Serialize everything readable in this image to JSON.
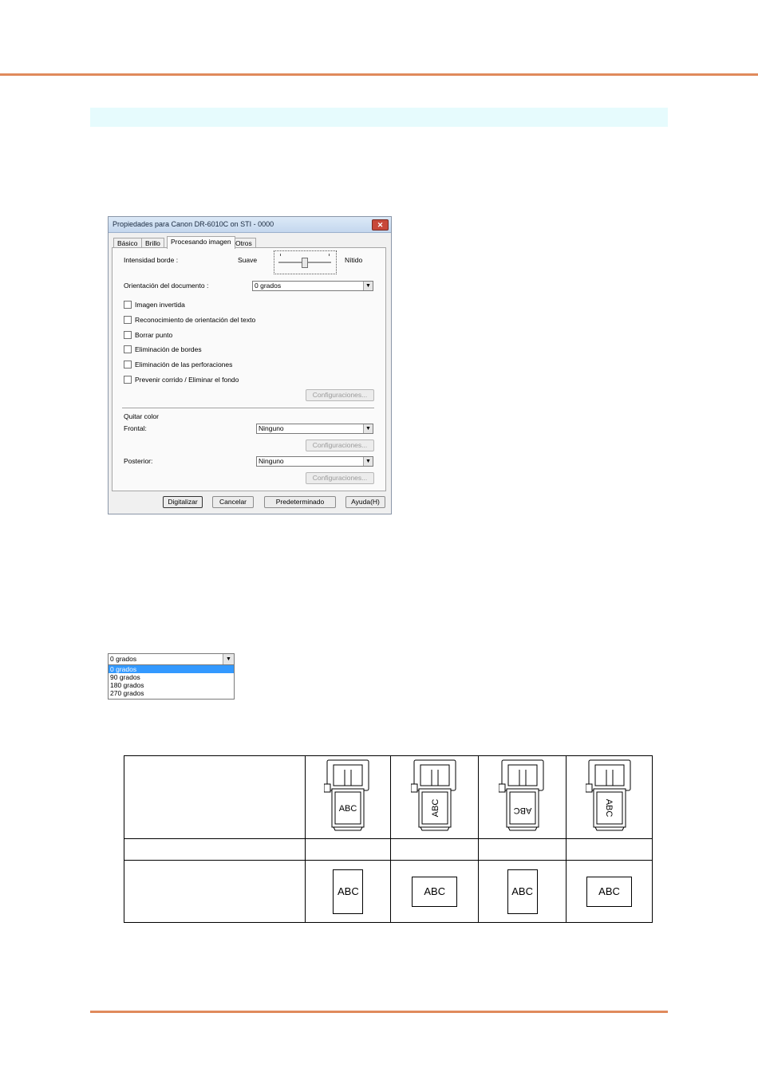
{
  "dialog": {
    "title": "Propiedades para Canon DR-6010C on STI - 0000",
    "close_glyph": "✕",
    "tabs": [
      "Básico",
      "Brillo",
      "Procesando imagen",
      "Otros"
    ],
    "edge_label": "Intensidad borde :",
    "soft_label": "Suave",
    "sharp_label": "Nítido",
    "orientation_label": "Orientación del documento :",
    "orientation_value": "0 grados",
    "checkboxes": [
      "Imagen invertida",
      "Reconocimiento de orientación del texto",
      "Borrar punto",
      "Eliminación de bordes",
      "Eliminación de las perforaciones",
      "Prevenir corrido / Eliminar el fondo"
    ],
    "settings_label": "Configuraciones...",
    "dropout_label": "Quitar color",
    "front_label": "Frontal:",
    "front_value": "Ninguno",
    "back_label": "Posterior:",
    "back_value": "Ninguno",
    "buttons": [
      "Digitalizar",
      "Cancelar",
      "Predeterminado",
      "Ayuda(H)"
    ]
  },
  "dropdown": {
    "selected": "0 grados",
    "options": [
      "0 grados",
      "90 grados",
      "180 grados",
      "270 grados"
    ],
    "highlighted_index": 0
  },
  "orientation_table": {
    "scanner_feed_labels": [
      "ABC",
      "ABC",
      "ABC",
      "ABC"
    ],
    "output_labels": [
      "ABC",
      "ABC",
      "ABC",
      "ABC"
    ]
  },
  "colors": {
    "rule": "#e08a5c",
    "band": "#e6fbfd",
    "selection": "#3399ff"
  }
}
